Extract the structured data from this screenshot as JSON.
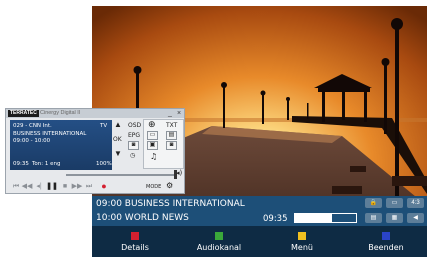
{
  "colors": {
    "osd_bg": "#0e2b44",
    "osd_info_bg": "#1d4f78",
    "red": "#d42030",
    "green": "#3aa83a",
    "yellow": "#f0c020",
    "blue": "#2a44c8"
  },
  "window": {
    "brand": "TERRATEC",
    "title": "Cinergy Digital II",
    "minimize": "_",
    "close": "×",
    "display": {
      "channel": "029 - CNN Int.",
      "mode": "TV",
      "program": "BUSINESS INTERNATIONAL",
      "time_range": "09:00 - 10:00",
      "clock": "09:35",
      "audio": "Ton: 1 eng",
      "volume": "100%"
    },
    "controls": {
      "osd": "OSD",
      "ok": "OK",
      "epg": "EPG",
      "txt": "TXT",
      "mode": "MODE"
    }
  },
  "osd": {
    "now": "09:00 BUSINESS INTERNATIONAL",
    "next": "10:00 WORLD NEWS",
    "time": "09:35",
    "progress": 0.6,
    "aspect": "4:3",
    "buttons": [
      {
        "label": "Details"
      },
      {
        "label": "Audiokanal"
      },
      {
        "label": "Menü"
      },
      {
        "label": "Beenden"
      }
    ]
  }
}
